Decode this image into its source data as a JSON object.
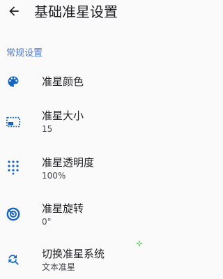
{
  "header": {
    "title": "基础准星设置",
    "back_icon": "arrow-back-icon"
  },
  "section": {
    "title": "常规设置",
    "accent_color": "#4a78d6"
  },
  "settings": [
    {
      "key": "color",
      "title": "准星颜色",
      "summary": "",
      "icon": "palette-icon"
    },
    {
      "key": "size",
      "title": "准星大小",
      "summary": "15",
      "icon": "size-icon"
    },
    {
      "key": "opacity",
      "title": "准星透明度",
      "summary": "100%",
      "icon": "dots-grid-icon"
    },
    {
      "key": "rotation",
      "title": "准星旋转",
      "summary": "0°",
      "icon": "rotation-icon"
    },
    {
      "key": "switch",
      "title": "切换准星系统",
      "summary": "文本准星",
      "icon": "switch-system-icon"
    }
  ],
  "crosshair": {
    "color": "#22cc22",
    "icon": "crosshair-icon"
  },
  "colors": {
    "icon": "#1565c0",
    "text": "#1c1b1f",
    "subtext": "#49454f"
  }
}
